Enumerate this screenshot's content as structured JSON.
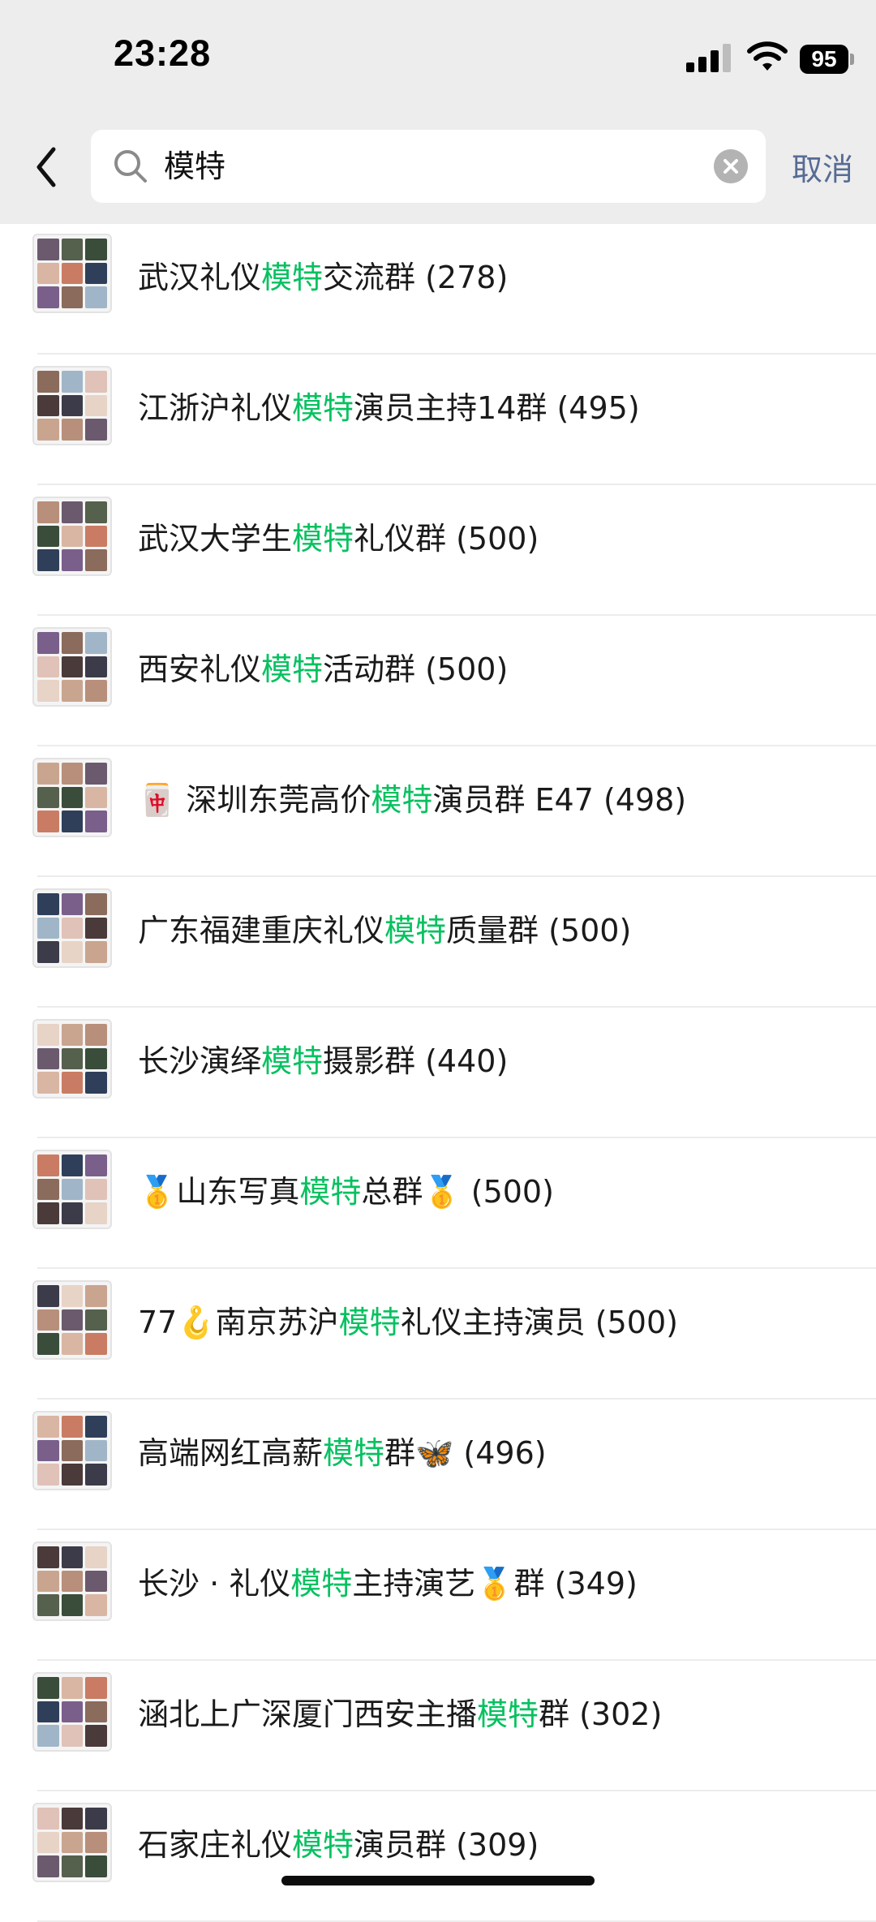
{
  "status_bar": {
    "time": "23:28",
    "battery": "95",
    "icons": [
      "signal-icon",
      "wifi-icon",
      "battery-icon"
    ]
  },
  "search": {
    "query": "模特",
    "cancel_label": "取消",
    "icons": [
      "back-chevron-icon",
      "search-icon",
      "clear-icon"
    ]
  },
  "colors": {
    "highlight": "#07c160",
    "cancel": "#576b95",
    "header_bg": "#ededed"
  },
  "results": [
    {
      "pre": "武汉礼仪",
      "hl": "模特",
      "post": "交流群 (278)"
    },
    {
      "pre": "江浙沪礼仪",
      "hl": "模特",
      "post": "演员主持14群 (495)"
    },
    {
      "pre": "武汉大学生",
      "hl": "模特",
      "post": "礼仪群 (500)"
    },
    {
      "pre": "西安礼仪",
      "hl": "模特",
      "post": "活动群 (500)"
    },
    {
      "pre": "🀄 深圳东莞高价",
      "hl": "模特",
      "post": "演员群 E47 (498)"
    },
    {
      "pre": "广东福建重庆礼仪",
      "hl": "模特",
      "post": "质量群 (500)"
    },
    {
      "pre": "长沙演绎",
      "hl": "模特",
      "post": "摄影群 (440)"
    },
    {
      "pre": "🥇山东写真",
      "hl": "模特",
      "post": "总群🥇 (500)"
    },
    {
      "pre": "77🪝南京苏沪",
      "hl": "模特",
      "post": "礼仪主持演员 (500)"
    },
    {
      "pre": "高端网红高薪",
      "hl": "模特",
      "post": "群🦋 (496)"
    },
    {
      "pre": "长沙 · 礼仪",
      "hl": "模特",
      "post": "主持演艺🥇群 (349)"
    },
    {
      "pre": "涵北上广深厦门西安主播",
      "hl": "模特",
      "post": "群 (302)"
    },
    {
      "pre": "石家庄礼仪",
      "hl": "模特",
      "post": "演员群 (309)"
    }
  ]
}
